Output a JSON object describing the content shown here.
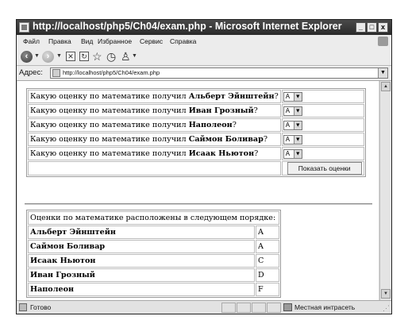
{
  "window": {
    "title": "http://localhost/php5/Ch04/exam.php - Microsoft Internet Explorer",
    "controls": {
      "minimize": "_",
      "maximize": "□",
      "close": "x"
    }
  },
  "menu": [
    "Файл",
    "Правка",
    "Вид",
    "Избранное",
    "Сервис",
    "Справка"
  ],
  "toolbar": {
    "icons": [
      "back-icon",
      "forward-icon",
      "stop-icon",
      "refresh-icon",
      "favorites-star-icon",
      "history-icon",
      "print-icon"
    ]
  },
  "address": {
    "label": "Адрес:",
    "url": "http://localhost/php5/Ch04/exam.php"
  },
  "quiz": {
    "question_prefix": "Какую оценку по математике получил",
    "rows": [
      {
        "name": "Альберт Эйнштейн",
        "selected": "A"
      },
      {
        "name": "Иван Грозный",
        "selected": "A"
      },
      {
        "name": "Наполеон",
        "selected": "A"
      },
      {
        "name": "Саймон Боливар",
        "selected": "A"
      },
      {
        "name": "Исаак Ньютон",
        "selected": "A"
      }
    ],
    "submit_label": "Показать оценки"
  },
  "results": {
    "header": "Оценки по математике расположены в следующем порядке:",
    "rows": [
      {
        "name": "Альберт Эйнштейн",
        "grade": "A"
      },
      {
        "name": "Саймон Боливар",
        "grade": "A"
      },
      {
        "name": "Исаак Ньютон",
        "grade": "C"
      },
      {
        "name": "Иван Грозный",
        "grade": "D"
      },
      {
        "name": "Наполеон",
        "grade": "F"
      }
    ]
  },
  "status": {
    "text": "Готово",
    "zone": "Местная интрасеть"
  }
}
